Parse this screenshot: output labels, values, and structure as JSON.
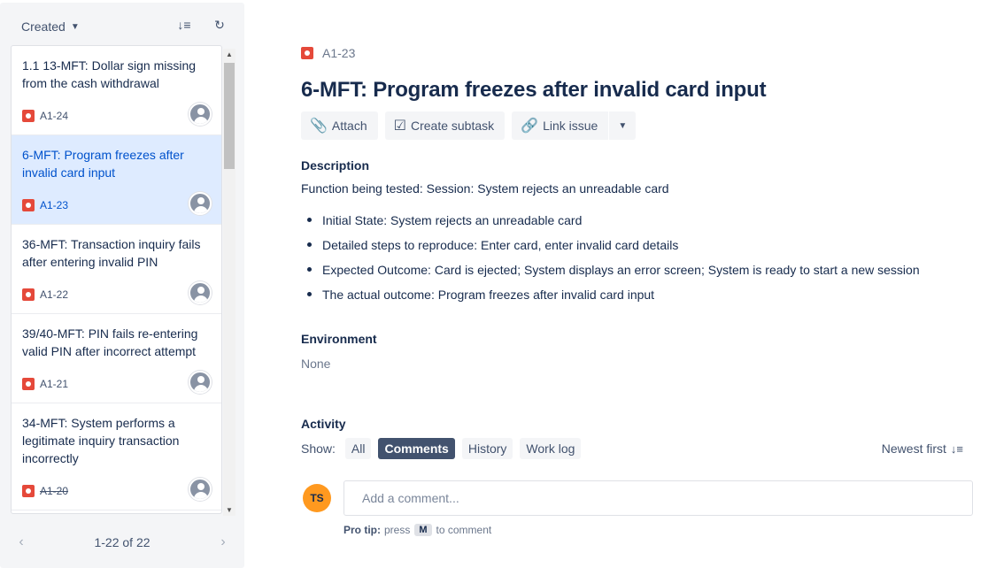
{
  "sidebar": {
    "sort_label": "Created",
    "issues": [
      {
        "title": "1.1 13-MFT: Dollar sign missing from the cash withdrawal",
        "key": "A1-24",
        "resolved": false,
        "selected": false
      },
      {
        "title": "6-MFT: Program freezes after invalid card input",
        "key": "A1-23",
        "resolved": false,
        "selected": true
      },
      {
        "title": "36-MFT: Transaction inquiry fails after entering invalid PIN",
        "key": "A1-22",
        "resolved": false,
        "selected": false
      },
      {
        "title": "39/40-MFT: PIN fails re-entering valid PIN after incorrect attempt",
        "key": "A1-21",
        "resolved": false,
        "selected": false
      },
      {
        "title": "34-MFT: System performs a legitimate inquiry transaction incorrectly",
        "key": "A1-20",
        "resolved": true,
        "selected": false
      }
    ],
    "pager_text": "1-22 of 22"
  },
  "issue": {
    "key": "A1-23",
    "title": "6-MFT: Program freezes after invalid card input",
    "toolbar": {
      "attach": "Attach",
      "create_subtask": "Create subtask",
      "link_issue": "Link issue"
    },
    "description_label": "Description",
    "description_text": "Function being tested: Session: System rejects an unreadable card",
    "bullets": [
      "Initial State: System rejects an unreadable card",
      "Detailed steps to reproduce: Enter card, enter invalid card details",
      "Expected Outcome: Card is ejected; System displays an error screen; System is ready to start a new session",
      "The actual outcome: Program freezes after invalid card input"
    ],
    "environment_label": "Environment",
    "environment_value": "None"
  },
  "activity": {
    "label": "Activity",
    "show_label": "Show:",
    "filters": [
      "All",
      "Comments",
      "History",
      "Work log"
    ],
    "active_filter": "Comments",
    "sort_label": "Newest first",
    "user_initials": "TS",
    "comment_placeholder": "Add a comment...",
    "pro_tip_label": "Pro tip:",
    "pro_tip_before": "press",
    "pro_tip_key": "M",
    "pro_tip_after": "to comment"
  },
  "colors": {
    "accent": "#0052cc",
    "selected_bg": "#deebff",
    "bug": "#e5493a",
    "avatar": "#ff991f",
    "active_filter_bg": "#42526e"
  }
}
